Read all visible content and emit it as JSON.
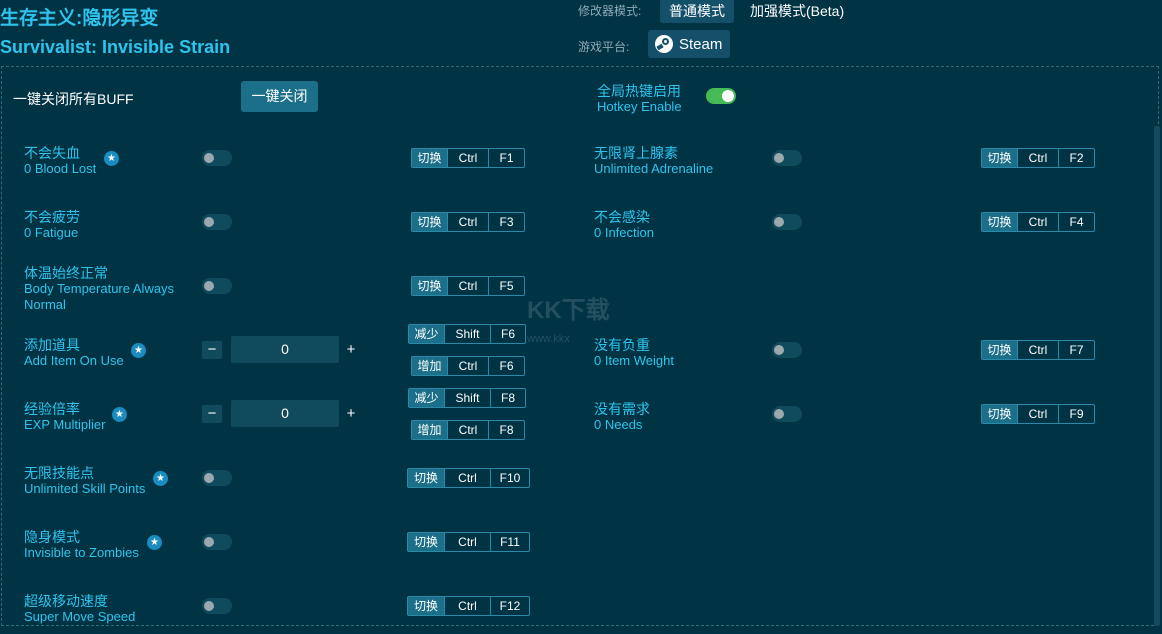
{
  "header": {
    "title_cn": "生存主义:隐形异变",
    "title_en": "Survivalist: Invisible Strain",
    "mode_label": "修改器模式:",
    "mode_normal": "普通模式",
    "mode_beta": "加强模式(Beta)",
    "platform_label": "游戏平台:",
    "platform": "Steam"
  },
  "global": {
    "close_all_label": "一键关闭所有BUFF",
    "close_all_button": "一键关闭",
    "hotkey_enable_cn": "全局热键启用",
    "hotkey_enable_en": "Hotkey Enable",
    "hotkey_enable_on": true
  },
  "watermark": {
    "text": "KK下载",
    "sub": "www.kkx"
  },
  "cheats": [
    {
      "cn": "不会失血",
      "en": "0 Blood Lost",
      "star": true,
      "hotkeys": [
        [
          "切换",
          "Ctrl",
          "F1"
        ]
      ]
    },
    {
      "cn": "不会疲劳",
      "en": "0 Fatigue",
      "star": false,
      "hotkeys": [
        [
          "切换",
          "Ctrl",
          "F3"
        ]
      ]
    },
    {
      "cn": "体温始终正常",
      "en1": "Body Temperature Always",
      "en2": "Normal",
      "star": false,
      "hotkeys": [
        [
          "切换",
          "Ctrl",
          "F5"
        ]
      ]
    },
    {
      "cn": "添加道具",
      "en": "Add Item On Use",
      "star": true,
      "value": "0",
      "hotkeys": [
        [
          "减少",
          "Shift",
          "F6"
        ],
        [
          "增加",
          "Ctrl",
          "F6"
        ]
      ]
    },
    {
      "cn": "经验倍率",
      "en": "EXP Multiplier",
      "star": true,
      "value": "0",
      "hotkeys": [
        [
          "减少",
          "Shift",
          "F8"
        ],
        [
          "增加",
          "Ctrl",
          "F8"
        ]
      ]
    },
    {
      "cn": "无限技能点",
      "en": "Unlimited Skill Points",
      "star": true,
      "hotkeys": [
        [
          "切换",
          "Ctrl",
          "F10"
        ]
      ]
    },
    {
      "cn": "隐身模式",
      "en": "Invisible to Zombies",
      "star": true,
      "hotkeys": [
        [
          "切换",
          "Ctrl",
          "F11"
        ]
      ]
    },
    {
      "cn": "超级移动速度",
      "en": "Super Move Speed",
      "star": false,
      "hotkeys": [
        [
          "切换",
          "Ctrl",
          "F12"
        ]
      ]
    },
    {
      "cn": "无限肾上腺素",
      "en": "Unlimited Adrenaline",
      "star": false,
      "hotkeys": [
        [
          "切换",
          "Ctrl",
          "F2"
        ]
      ]
    },
    {
      "cn": "不会感染",
      "en": "0 Infection",
      "star": false,
      "hotkeys": [
        [
          "切换",
          "Ctrl",
          "F4"
        ]
      ]
    },
    {
      "cn": "没有负重",
      "en": "0 Item Weight",
      "star": false,
      "hotkeys": [
        [
          "切换",
          "Ctrl",
          "F7"
        ]
      ]
    },
    {
      "cn": "没有需求",
      "en": "0 Needs",
      "star": false,
      "hotkeys": [
        [
          "切换",
          "Ctrl",
          "F9"
        ]
      ]
    }
  ]
}
